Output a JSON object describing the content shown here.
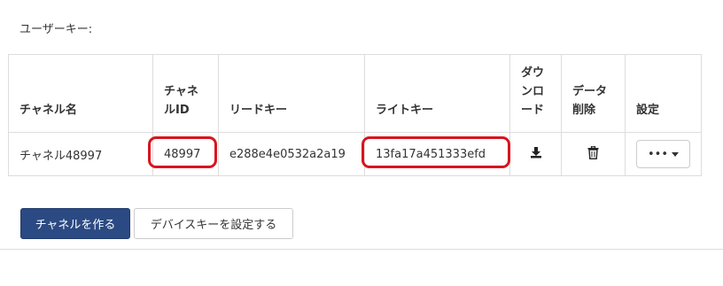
{
  "section": {
    "user_key_label": "ユーザーキー:"
  },
  "table": {
    "headers": {
      "channel_name": "チャネル名",
      "channel_id": "チャネルID",
      "read_key": "リードキー",
      "write_key": "ライトキー",
      "download": "ダウンロード",
      "delete": "データ削除",
      "settings": "設定"
    },
    "row": {
      "channel_name": "チャネル48997",
      "channel_id": "48997",
      "read_key": "e288e4e0532a2a19",
      "write_key": "13fa17a451333efd",
      "settings_button": "•••"
    }
  },
  "buttons": {
    "create_channel": "チャネルを作る",
    "set_device_key": "デバイスキーを設定する"
  },
  "colors": {
    "primary": "#2b4a83",
    "highlight": "#d9141e",
    "border": "#dddddd"
  },
  "icons": [
    "download-icon",
    "trash-icon",
    "caret-down-icon"
  ]
}
